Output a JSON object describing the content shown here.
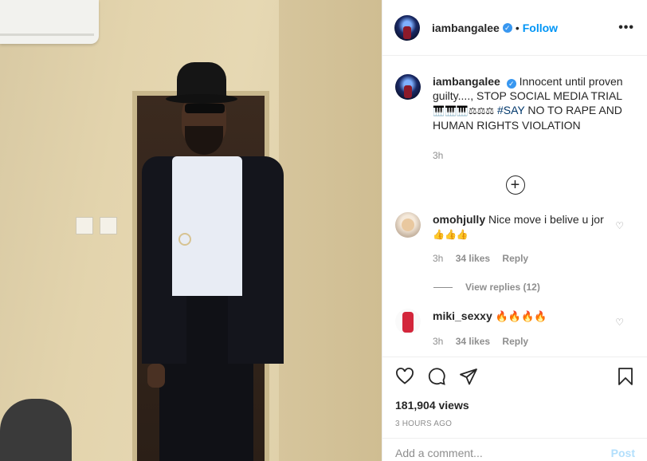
{
  "header": {
    "username": "iambangalee",
    "separator": "•",
    "follow_label": "Follow",
    "more_label": "•••"
  },
  "caption": {
    "username": "iambangalee",
    "text_1": "Innocent until proven guilty...., STOP SOCIAL MEDIA TRIAL",
    "emoji_1": "🎹🎹🎹",
    "emoji_2": "⚖⚖⚖",
    "hashtag": "#SAY",
    "text_2": "NO TO RAPE AND HUMAN RIGHTS VIOLATION",
    "time": "3h"
  },
  "load_more_label": "+",
  "comments": [
    {
      "username": "omohjully",
      "text": "Nice move i belive u jor",
      "emoji": "👍👍👍",
      "time": "3h",
      "likes": "34 likes",
      "reply_label": "Reply",
      "view_replies": "View replies (12)"
    },
    {
      "username": "miki_sexxy",
      "text": "",
      "emoji": "🔥🔥🔥🔥",
      "time": "3h",
      "likes": "34 likes",
      "reply_label": "Reply"
    }
  ],
  "stats": {
    "views": "181,904 views",
    "ago": "3 HOURS AGO"
  },
  "add_comment": {
    "placeholder": "Add a comment...",
    "post_label": "Post"
  },
  "colors": {
    "accent": "#0095f6",
    "verified": "#3897f0",
    "muted": "#8e8e8e",
    "post_disabled": "#b2dffc"
  }
}
